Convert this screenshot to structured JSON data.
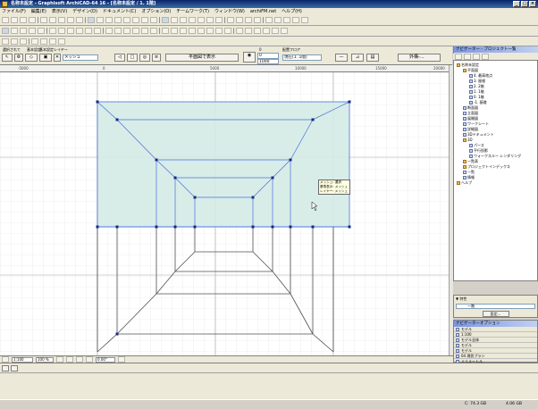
{
  "window": {
    "title": "名称未設定 - Graphisoft ArchiCAD-64 16 - [名称未設定 / 1. 1階]",
    "controls": [
      "_",
      "□",
      "×"
    ]
  },
  "menu": [
    "ファイル(F)",
    "編集(E)",
    "表示(V)",
    "デザイン(D)",
    "ドキュメント(C)",
    "オプション(O)",
    "チームワーク(T)",
    "ウィンドウ(W)",
    "archiFM.net",
    "ヘルプ(H)"
  ],
  "infobox": {
    "tool_label": "選択されて",
    "geometry_label": "基本設定",
    "layer_label": "基本設定レイヤー",
    "method_value": "メッシュ",
    "elevation_label": "0",
    "elevation_value": "0",
    "offset_value": "1000",
    "story_label": "配置フロア",
    "story_value": "現在(1. 1階)",
    "pattern_value": "外構-...",
    "plane_button": "平面図で表示"
  },
  "ruler": [
    "-5000",
    "0",
    "5000",
    "10000",
    "15000",
    "20000"
  ],
  "tooltip": {
    "lines": [
      "メッシュ: 選択",
      "基準表示: メッシュ",
      "レイヤー: メッシュ"
    ]
  },
  "scroll": {
    "scale": "1:100",
    "zoom": "100 %",
    "angle": "0.00°"
  },
  "navigator": {
    "header": "ナビゲーター - プロジェクト一覧",
    "tree": [
      {
        "label": "名称未設定",
        "depth": 0,
        "icon": "fold"
      },
      {
        "label": "平面図",
        "depth": 1,
        "icon": "fold"
      },
      {
        "label": "4. 最高地点",
        "depth": 2,
        "icon": "file"
      },
      {
        "label": "3. 屋根",
        "depth": 2,
        "icon": "file"
      },
      {
        "label": "2. 2階",
        "depth": 2,
        "icon": "file"
      },
      {
        "label": "1. 1階",
        "depth": 2,
        "icon": "file"
      },
      {
        "label": "0. 1階",
        "depth": 2,
        "icon": "file"
      },
      {
        "label": "-1. 基礎",
        "depth": 2,
        "icon": "file"
      },
      {
        "label": "断面図",
        "depth": 1,
        "icon": "file"
      },
      {
        "label": "立面図",
        "depth": 1,
        "icon": "file"
      },
      {
        "label": "展開図",
        "depth": 1,
        "icon": "file"
      },
      {
        "label": "ワークシート",
        "depth": 1,
        "icon": "file"
      },
      {
        "label": "詳細図",
        "depth": 1,
        "icon": "file"
      },
      {
        "label": "3Dドキュメント",
        "depth": 1,
        "icon": "file"
      },
      {
        "label": "3D",
        "depth": 1,
        "icon": "fold"
      },
      {
        "label": "パース",
        "depth": 2,
        "icon": "file"
      },
      {
        "label": "平行投影",
        "depth": 2,
        "icon": "file"
      },
      {
        "label": "ウォークスルー レンダリング",
        "depth": 2,
        "icon": "file"
      },
      {
        "label": "一覧表",
        "depth": 1,
        "icon": "fold"
      },
      {
        "label": "プロジェクトインデックス",
        "depth": 1,
        "icon": "fold"
      },
      {
        "label": "一覧",
        "depth": 1,
        "icon": "file"
      },
      {
        "label": "情報",
        "depth": 1,
        "icon": "file"
      },
      {
        "label": "ヘルプ",
        "depth": 0,
        "icon": "fold"
      }
    ]
  },
  "properties": {
    "header": "▼ 特性",
    "field_label": "一階",
    "button": "設定..."
  },
  "nav_options": {
    "header": "ナビゲーターオプション",
    "rows": [
      "モデル",
      "1:100",
      "モデル全体",
      "モデル",
      "モデル",
      "04 現状プラン",
      "ミリメートル"
    ]
  },
  "status": {
    "disk_c": "C: 74.3 GB",
    "disk_d": "4.06 GB"
  },
  "colors": {
    "mesh_fill": "#d4ebe6",
    "selection_blue": "#4a6fe0",
    "title_blue": "#0a246a"
  }
}
